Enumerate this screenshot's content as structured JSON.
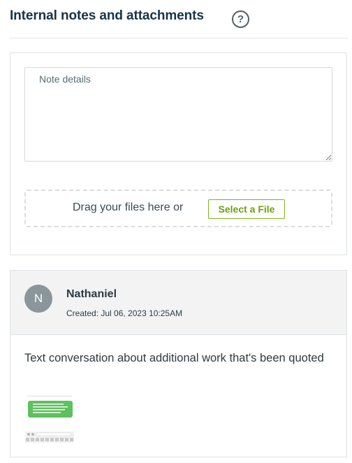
{
  "section": {
    "title": "Internal notes and attachments",
    "help_icon": "question-circle-icon"
  },
  "composer": {
    "note_placeholder": "Note details",
    "note_value": "",
    "drop_text": "Drag your files here or",
    "select_file_label": "Select a File",
    "accent_color": "#6aa112"
  },
  "notes": [
    {
      "avatar_initial": "N",
      "author": "Nathaniel",
      "created": "Created: Jul 06, 2023 10:25AM",
      "body": "Text conversation about additional work that's been quoted",
      "attachment": {
        "type": "image-thumbnail",
        "content": "text-message-screenshot"
      }
    }
  ]
}
